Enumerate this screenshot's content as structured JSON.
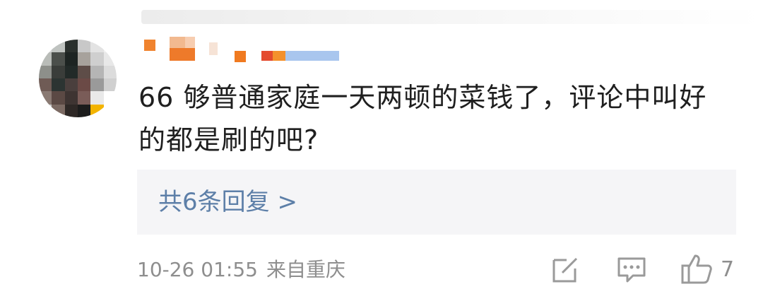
{
  "comment": {
    "text": "66 够普通家庭一天两顿的菜钱了，评论中叫好的都是刷的吧?",
    "replies_link": "共6条回复 >",
    "date": "10-26 01:55",
    "location": "来自重庆",
    "like_count": "7"
  },
  "icons": {
    "share": "share-edit-icon",
    "reply": "comment-icon",
    "like": "thumbs-up-icon"
  },
  "colors": {
    "text": "#1f1f1f",
    "link": "#5d7fa8",
    "meta": "#8e8e8e",
    "reply_bg": "#f5f5f7",
    "icon": "#9a9a9a"
  }
}
